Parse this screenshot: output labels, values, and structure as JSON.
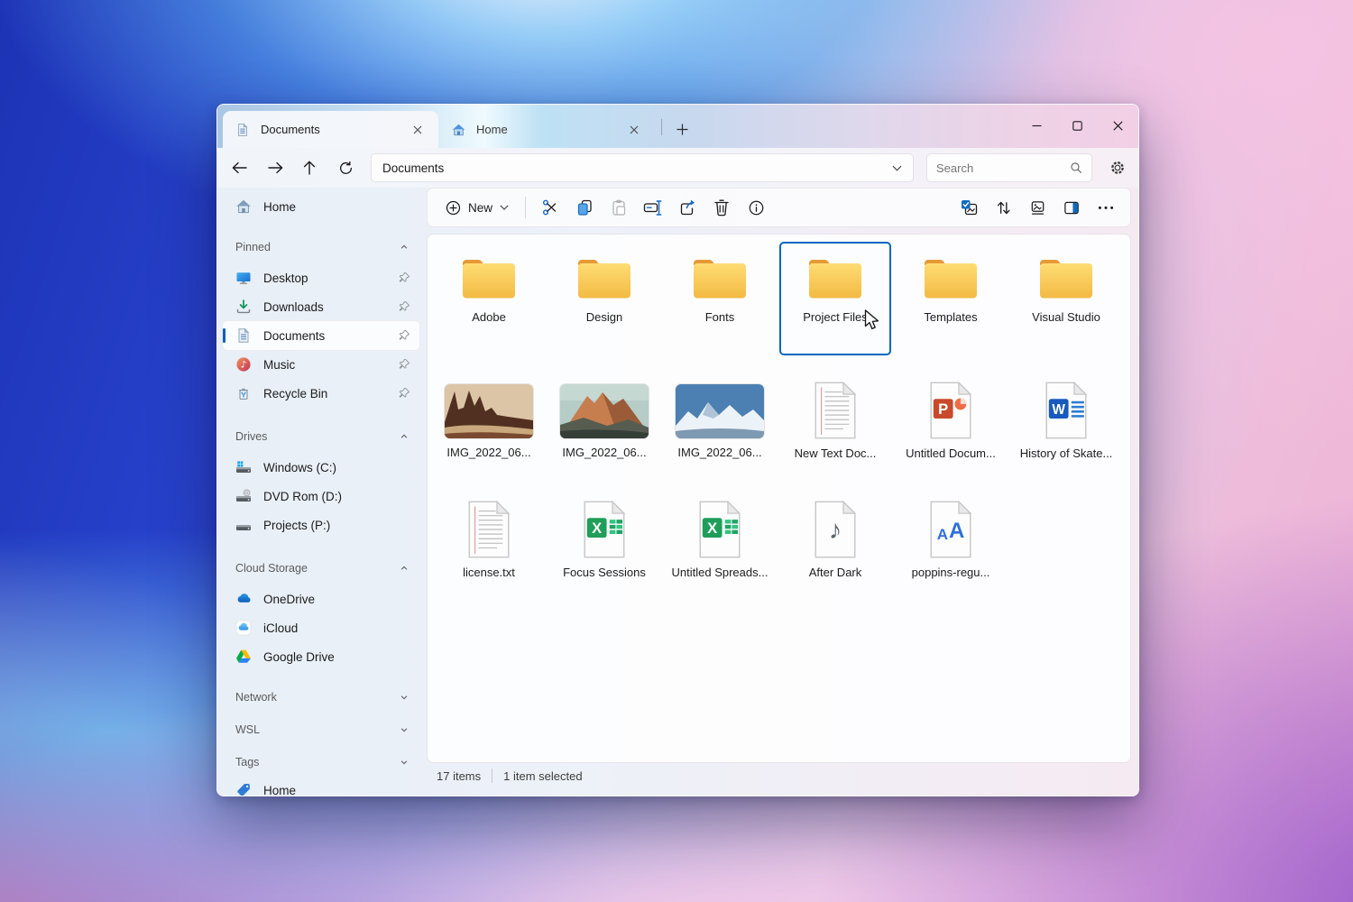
{
  "accent_color": "#005FB8",
  "selection_border_color": "#0067C0",
  "titlebar": {
    "tabs": [
      {
        "label": "Documents",
        "active": true,
        "icon": "document-icon"
      },
      {
        "label": "Home",
        "active": false,
        "icon": "home-icon"
      }
    ],
    "window_controls": [
      "minimize",
      "maximize",
      "close"
    ]
  },
  "nav": {
    "address": "Documents",
    "search_placeholder": "Search",
    "icons": [
      "back-arrow-icon",
      "forward-arrow-icon",
      "up-arrow-icon",
      "refresh-icon",
      "chevron-down-icon",
      "search-icon",
      "gear-icon"
    ]
  },
  "toolbar": {
    "new_label": "New",
    "left_icons": [
      "new-plus-icon",
      "chevron-down-icon",
      "cut-icon",
      "copy-icon",
      "paste-icon",
      "rename-icon",
      "share-icon",
      "delete-icon",
      "info-icon"
    ],
    "right_icons": [
      "select-all-icon",
      "sort-icon",
      "view-icon",
      "details-pane-icon",
      "more-ellipsis-icon"
    ]
  },
  "sidebar": {
    "home_label": "Home",
    "sections": [
      {
        "title": "Pinned",
        "expanded": true,
        "items": [
          {
            "label": "Desktop",
            "icon": "desktop-icon",
            "pinned": true
          },
          {
            "label": "Downloads",
            "icon": "downloads-icon",
            "pinned": true
          },
          {
            "label": "Documents",
            "icon": "documents-icon",
            "pinned": true,
            "selected": true
          },
          {
            "label": "Music",
            "icon": "music-icon",
            "pinned": true
          },
          {
            "label": "Recycle Bin",
            "icon": "recycle-bin-icon",
            "pinned": true
          }
        ]
      },
      {
        "title": "Drives",
        "expanded": true,
        "items": [
          {
            "label": "Windows (C:)",
            "icon": "drive-windows-icon"
          },
          {
            "label": "DVD Rom (D:)",
            "icon": "drive-dvd-icon"
          },
          {
            "label": "Projects (P:)",
            "icon": "drive-icon"
          }
        ]
      },
      {
        "title": "Cloud Storage",
        "expanded": true,
        "items": [
          {
            "label": "OneDrive",
            "icon": "onedrive-icon"
          },
          {
            "label": "iCloud",
            "icon": "icloud-icon"
          },
          {
            "label": "Google Drive",
            "icon": "google-drive-icon"
          }
        ]
      }
    ],
    "collapsed_sections": [
      {
        "title": "Network"
      },
      {
        "title": "WSL"
      },
      {
        "title": "Tags"
      }
    ],
    "tag_home_label": "Home"
  },
  "content": {
    "items": [
      {
        "label": "Adobe",
        "type": "folder"
      },
      {
        "label": "Design",
        "type": "folder"
      },
      {
        "label": "Fonts",
        "type": "folder"
      },
      {
        "label": "Project Files",
        "type": "folder",
        "selected": true
      },
      {
        "label": "Templates",
        "type": "folder"
      },
      {
        "label": "Visual Studio",
        "type": "folder"
      },
      {
        "label": "IMG_2022_06...",
        "type": "image"
      },
      {
        "label": "IMG_2022_06...",
        "type": "image"
      },
      {
        "label": "IMG_2022_06...",
        "type": "image"
      },
      {
        "label": "New Text Doc...",
        "type": "text-document"
      },
      {
        "label": "Untitled Docum...",
        "type": "powerpoint"
      },
      {
        "label": "History of Skate...",
        "type": "word"
      },
      {
        "label": "license.txt",
        "type": "text-document"
      },
      {
        "label": "Focus Sessions",
        "type": "excel"
      },
      {
        "label": "Untitled Spreads...",
        "type": "excel"
      },
      {
        "label": "After Dark",
        "type": "audio"
      },
      {
        "label": "poppins-regu...",
        "type": "font"
      }
    ]
  },
  "statusbar": {
    "count": "17 items",
    "selection": "1 item selected"
  }
}
